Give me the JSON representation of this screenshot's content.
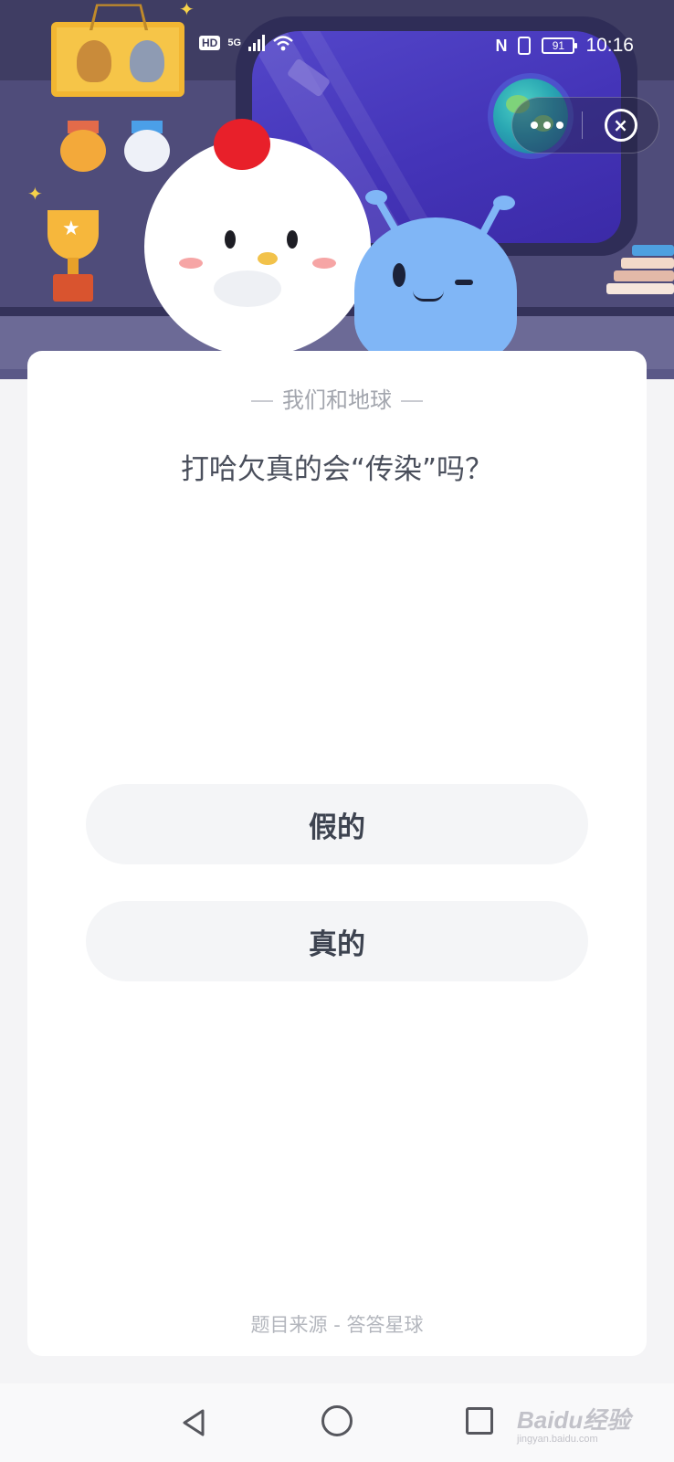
{
  "status_bar": {
    "hd": "HD",
    "network": "5G",
    "battery": "91",
    "time": "10:16"
  },
  "card": {
    "subtitle": "我们和地球",
    "question": "打哈欠真的会“传染”吗？",
    "options": [
      {
        "label": "假的"
      },
      {
        "label": "真的"
      }
    ],
    "source": "题目来源 - 答答星球"
  },
  "watermark": {
    "main": "Baidu经验",
    "sub": "jingyan.baidu.com"
  },
  "icons": {
    "more": "more-dots-icon",
    "close": "close-circle-icon",
    "back": "back-triangle-icon",
    "home": "home-circle-icon",
    "recent": "recent-square-icon"
  },
  "colors": {
    "scene_bg": "#54527c",
    "window_glass": "#4434b8",
    "card_bg": "#ffffff",
    "option_bg": "#f4f5f7",
    "question_text": "#4a4f5c"
  }
}
